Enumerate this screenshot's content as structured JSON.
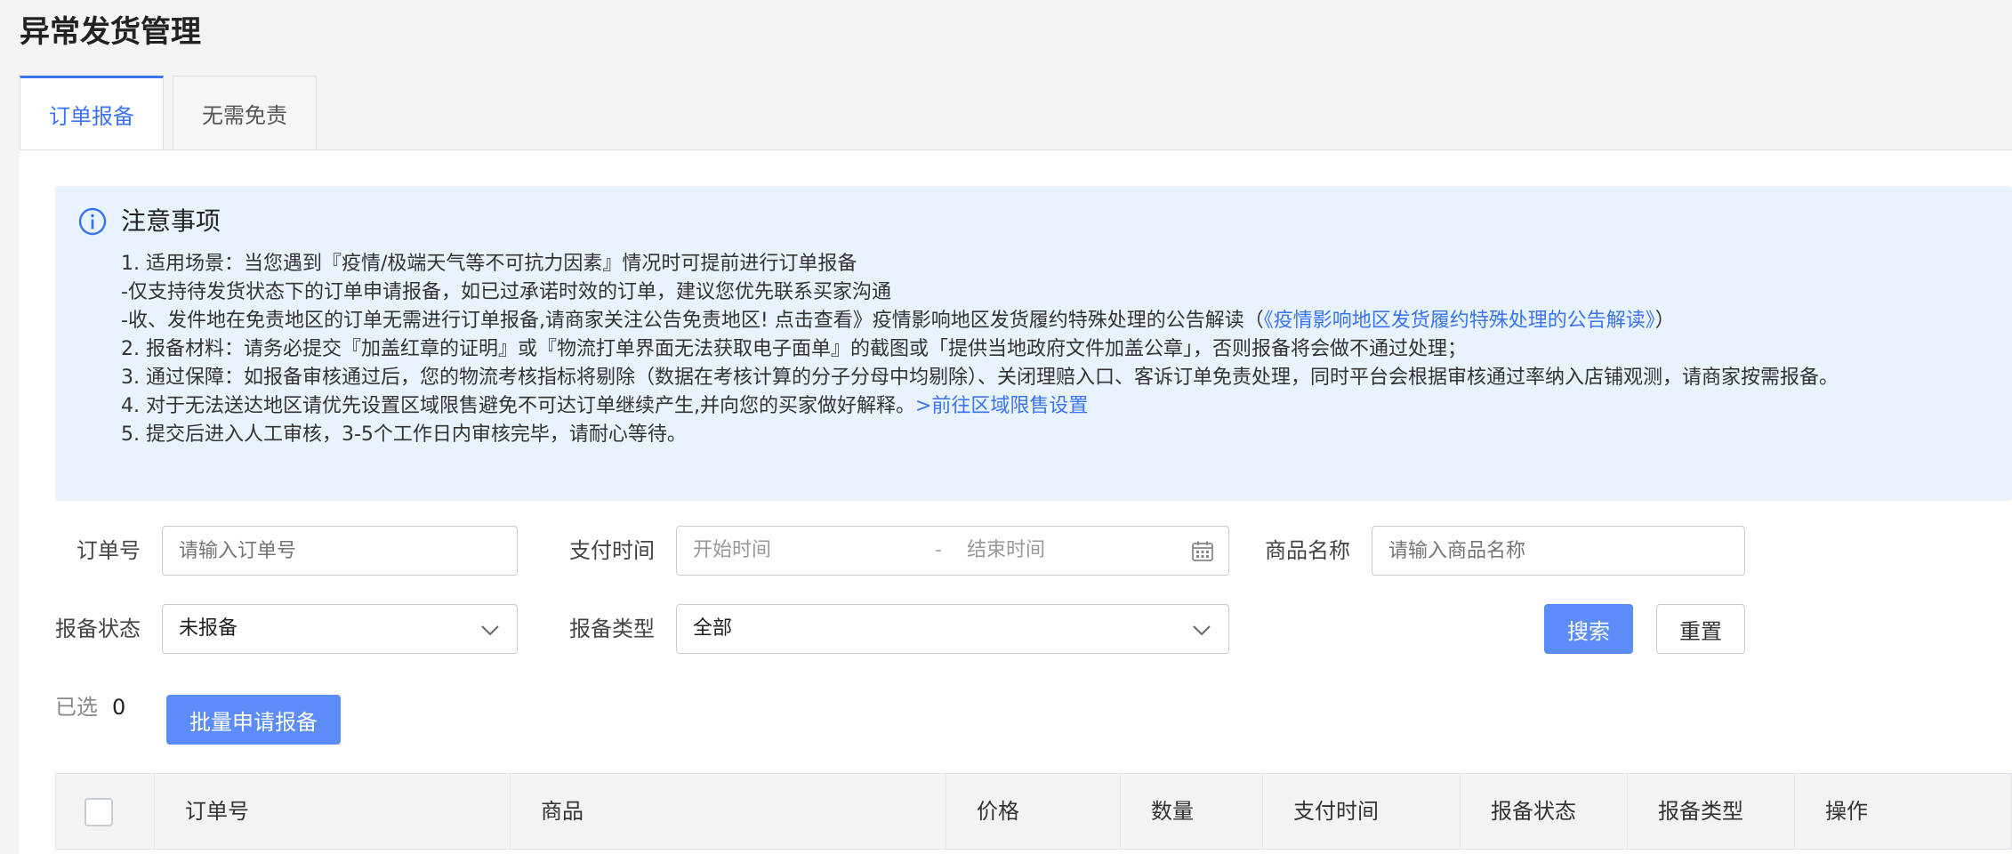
{
  "page": {
    "title": "异常发货管理"
  },
  "tabs": [
    {
      "label": "订单报备",
      "active": true
    },
    {
      "label": "无需免责",
      "active": false
    }
  ],
  "notice": {
    "icon": "info-icon",
    "title": "注意事项",
    "lines": {
      "l1": "1. 适用场景：当您遇到『疫情/极端天气等不可抗力因素』情况时可提前进行订单报备",
      "l2": "-仅支持待发货状态下的订单申请报备，如已过承诺时效的订单，建议您优先联系买家沟通",
      "l3_prefix": "-收、发件地在免责地区的订单无需进行订单报备,请商家关注公告免责地区! 点击查看》疫情影响地区发货履约特殊处理的公告解读（",
      "l3_link": "《疫情影响地区发货履约特殊处理的公告解读》",
      "l3_suffix": "）",
      "l4": "2. 报备材料：请务必提交『加盖红章的证明』或『物流打单界面无法获取电子面单』的截图或「提供当地政府文件加盖公章」，否则报备将会做不通过处理；",
      "l5": "3. 通过保障：如报备审核通过后，您的物流考核指标将剔除（数据在考核计算的分子分母中均剔除）、关闭理赔入口、客诉订单免责处理，同时平台会根据审核通过率纳入店铺观测，请商家按需报备。",
      "l6_prefix": "4. 对于无法送达地区请优先设置区域限售避免不可达订单继续产生,并向您的买家做好解释。",
      "l6_link": ">前往区域限售设置",
      "l7": "5. 提交后进入人工审核，3-5个工作日内审核完毕，请耐心等待。"
    }
  },
  "form": {
    "order_no": {
      "label": "订单号",
      "placeholder": "请输入订单号"
    },
    "pay_time": {
      "label": "支付时间",
      "start_placeholder": "开始时间",
      "separator": "-",
      "end_placeholder": "结束时间"
    },
    "product_name": {
      "label": "商品名称",
      "placeholder": "请输入商品名称"
    },
    "report_status": {
      "label": "报备状态",
      "value": "未报备"
    },
    "report_type": {
      "label": "报备类型",
      "value": "全部"
    },
    "search_label": "搜索",
    "reset_label": "重置"
  },
  "selection": {
    "label": "已选",
    "count": "0",
    "batch_label": "批量申请报备"
  },
  "table": {
    "columns": [
      "订单号",
      "商品",
      "价格",
      "数量",
      "支付时间",
      "报备状态",
      "报备类型",
      "操作"
    ]
  },
  "colors": {
    "accent": "#3b74f3",
    "primary_button": "#5b8cf7",
    "notice_bg": "#e8f3fd"
  }
}
